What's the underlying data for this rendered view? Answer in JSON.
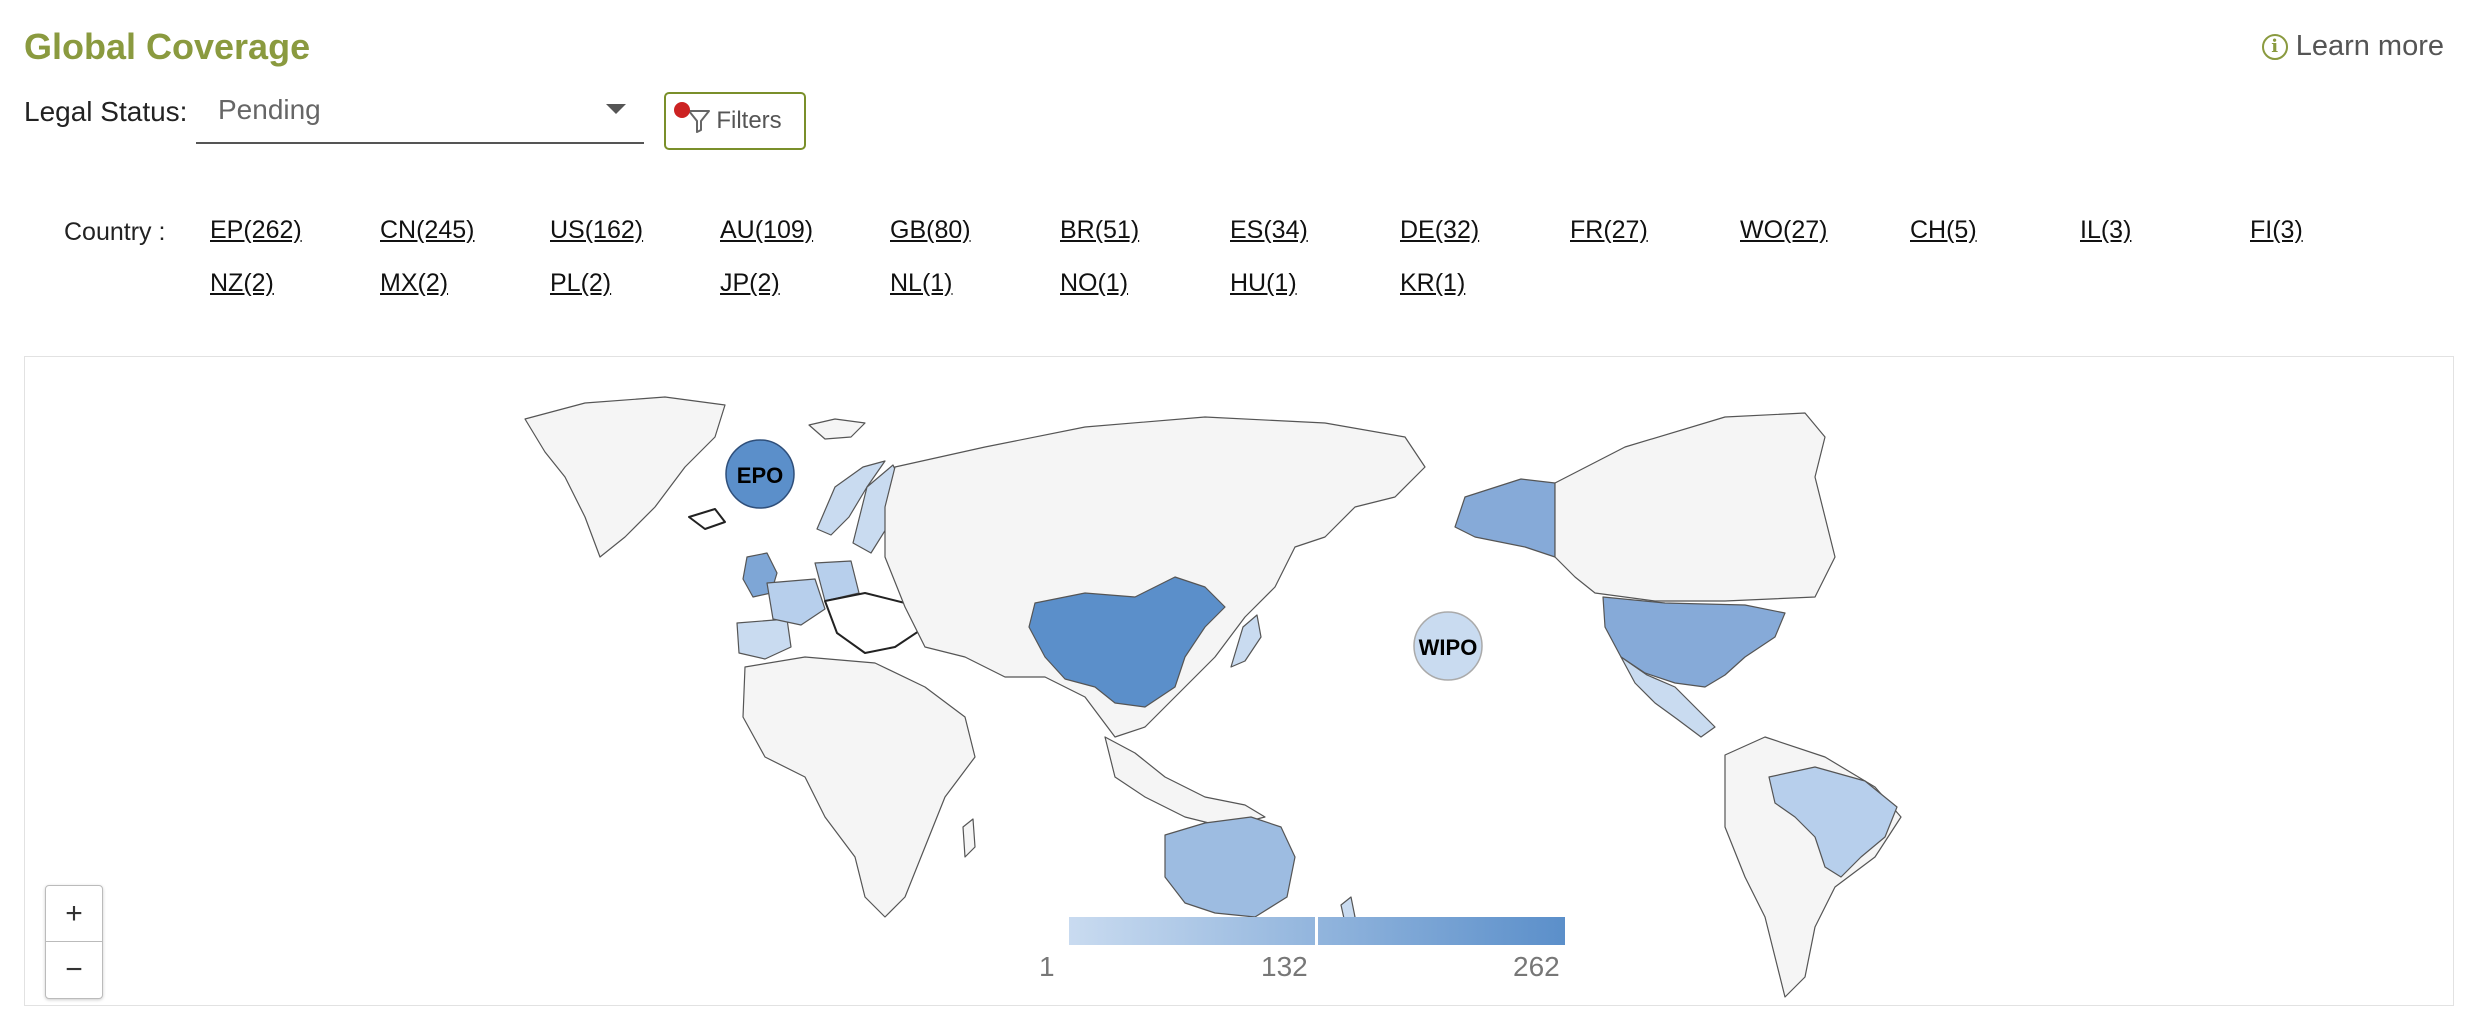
{
  "header": {
    "title": "Global Coverage",
    "learn_more": "Learn more",
    "info_icon": "info-icon"
  },
  "filters": {
    "legal_status_label": "Legal Status:",
    "legal_status_value": "Pending",
    "filters_button": "Filters"
  },
  "country": {
    "label": "Country :",
    "items": [
      "EP(262)",
      "CN(245)",
      "US(162)",
      "AU(109)",
      "GB(80)",
      "BR(51)",
      "ES(34)",
      "DE(32)",
      "FR(27)",
      "WO(27)",
      "CH(5)",
      "IL(3)",
      "FI(3)",
      "NZ(2)",
      "MX(2)",
      "PL(2)",
      "JP(2)",
      "NL(1)",
      "NO(1)",
      "HU(1)",
      "KR(1)"
    ]
  },
  "map": {
    "epo_label": "EPO",
    "wipo_label": "WIPO",
    "zoom_in": "+",
    "zoom_out": "−",
    "legend": {
      "min": "1",
      "mid": "132",
      "max": "262"
    },
    "colors": {
      "scale_low": "#c9dbf0",
      "scale_high": "#5b8fca",
      "no_data": "#f5f5f5",
      "brand_title": "#8a9a3f"
    }
  }
}
